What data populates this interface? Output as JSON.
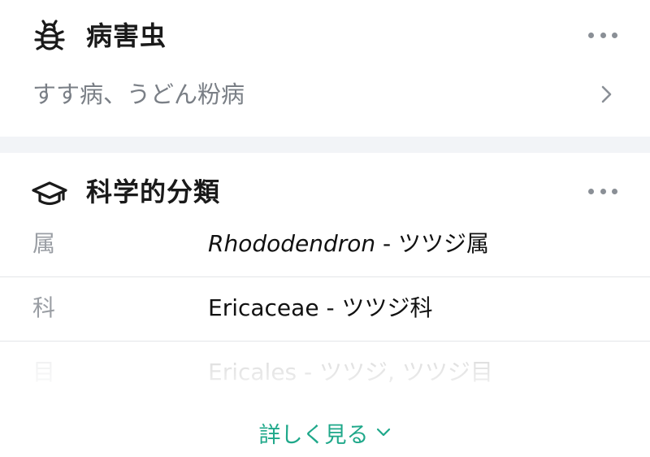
{
  "pests": {
    "title": "病害虫",
    "icon": "bug-icon",
    "summary": "すす病、うどん粉病"
  },
  "taxonomy": {
    "title": "科学的分類",
    "icon": "graduation-cap-icon",
    "rows": [
      {
        "label": "属",
        "value_italic": "Rhododendron",
        "value_rest": " - ツツジ属"
      },
      {
        "label": "科",
        "value_italic": "",
        "value_rest": "Ericaceae - ツツジ科"
      },
      {
        "label": "目",
        "value_italic": "",
        "value_rest": "Ericales - ツツジ, ツツジ目"
      }
    ],
    "see_more": "詳しく見る"
  },
  "colors": {
    "accent": "#1fa88a",
    "section_gap": "#f2f4f7",
    "muted_text": "#7a7f86"
  }
}
